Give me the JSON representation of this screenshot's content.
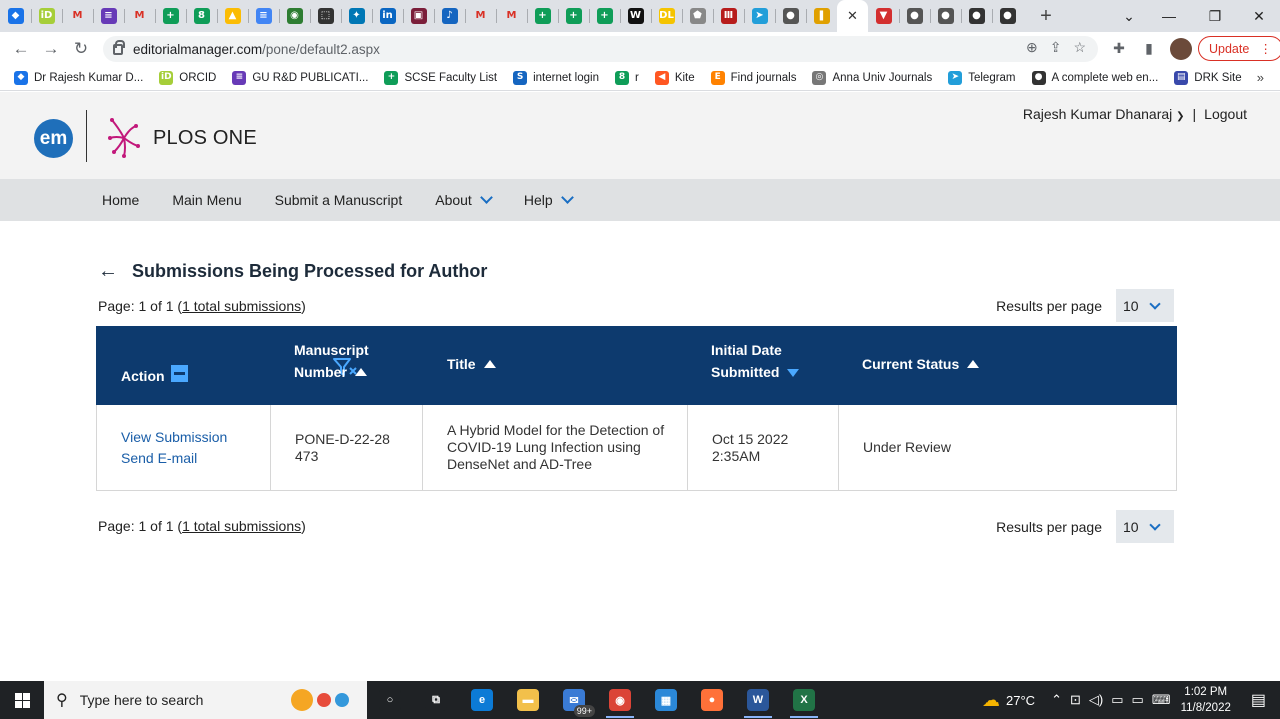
{
  "browser": {
    "tabs": [
      {
        "icon": "bookmark-star-icon",
        "color": "#1a73e8",
        "glyph": "◆"
      },
      {
        "icon": "orcid-icon",
        "color": "#a6ce39",
        "glyph": "iD"
      },
      {
        "icon": "gmail-icon",
        "color": "#ffffff",
        "glyph": "M"
      },
      {
        "icon": "form-icon",
        "color": "#673ab7",
        "glyph": "≡"
      },
      {
        "icon": "gmail-icon",
        "color": "#ffffff",
        "glyph": "M"
      },
      {
        "icon": "sheets-plus-icon",
        "color": "#0f9d58",
        "glyph": "+"
      },
      {
        "icon": "green-circle-icon",
        "color": "#0f9d58",
        "glyph": "8"
      },
      {
        "icon": "drive-icon",
        "color": "#fbbc04",
        "glyph": "▲"
      },
      {
        "icon": "docs-icon",
        "color": "#4285f4",
        "glyph": "≡"
      },
      {
        "icon": "eye-icon",
        "color": "#2e7d32",
        "glyph": "◉"
      },
      {
        "icon": "tool-icon",
        "color": "#333333",
        "glyph": "⬚"
      },
      {
        "icon": "bird-icon",
        "color": "#0077b5",
        "glyph": "✦"
      },
      {
        "icon": "linkedin-icon",
        "color": "#0a66c2",
        "glyph": "in"
      },
      {
        "icon": "journal-icon",
        "color": "#7b1e3a",
        "glyph": "▣"
      },
      {
        "icon": "scholar-icon",
        "color": "#1565c0",
        "glyph": "♪"
      },
      {
        "icon": "gmail-icon",
        "color": "#ffffff",
        "glyph": "M"
      },
      {
        "icon": "gmail-icon",
        "color": "#ffffff",
        "glyph": "M"
      },
      {
        "icon": "sheets-plus-icon",
        "color": "#0f9d58",
        "glyph": "+"
      },
      {
        "icon": "sheets-plus-icon",
        "color": "#0f9d58",
        "glyph": "+"
      },
      {
        "icon": "sheets-plus-icon",
        "color": "#0f9d58",
        "glyph": "+"
      },
      {
        "icon": "wikipedia-icon",
        "color": "#111111",
        "glyph": "W"
      },
      {
        "icon": "dl-icon",
        "color": "#f5c400",
        "glyph": "DL"
      },
      {
        "icon": "pentagon-icon",
        "color": "#888888",
        "glyph": "⬟"
      },
      {
        "icon": "pillar-icon",
        "color": "#b71c1c",
        "glyph": "Ⅲ"
      },
      {
        "icon": "telegram-icon",
        "color": "#229ed9",
        "glyph": "➤"
      },
      {
        "icon": "globe-icon",
        "color": "#555555",
        "glyph": "●"
      },
      {
        "icon": "rainbow-icon",
        "color": "#e0a000",
        "glyph": "❚"
      }
    ],
    "tabs_after": [
      {
        "icon": "vivaldi-red-icon",
        "color": "#d32f2f",
        "glyph": "▼"
      },
      {
        "icon": "globe-icon",
        "color": "#555555",
        "glyph": "●"
      },
      {
        "icon": "globe-icon",
        "color": "#555555",
        "glyph": "●"
      },
      {
        "icon": "github-icon",
        "color": "#333333",
        "glyph": "●"
      },
      {
        "icon": "github-icon",
        "color": "#333333",
        "glyph": "●"
      }
    ],
    "active_tab_close": "✕",
    "new_tab": "+",
    "url_host": "editorialmanager.com",
    "url_path": "/pone/default2.aspx",
    "update_label": "Update",
    "bookmarks": [
      {
        "label": "Dr Rajesh Kumar D...",
        "icon": "bookmark-star-icon",
        "color": "#1a73e8",
        "glyph": "◆"
      },
      {
        "label": "ORCID",
        "icon": "orcid-icon",
        "color": "#a6ce39",
        "glyph": "iD"
      },
      {
        "label": "GU R&D PUBLICATI...",
        "icon": "form-icon",
        "color": "#673ab7",
        "glyph": "≡"
      },
      {
        "label": "SCSE Faculty List",
        "icon": "sheets-plus-icon",
        "color": "#0f9d58",
        "glyph": "+"
      },
      {
        "label": "internet login",
        "icon": "s-icon",
        "color": "#1565c0",
        "glyph": "S"
      },
      {
        "label": "r",
        "icon": "green-circle-icon",
        "color": "#0f9d58",
        "glyph": "8"
      },
      {
        "label": "Kite",
        "icon": "kite-icon",
        "color": "#ff5722",
        "glyph": "◀"
      },
      {
        "label": "Find journals",
        "icon": "elsevier-icon",
        "color": "#ff8200",
        "glyph": "E"
      },
      {
        "label": "Anna Univ Journals",
        "icon": "anna-univ-icon",
        "color": "#777777",
        "glyph": "◎"
      },
      {
        "label": "Telegram",
        "icon": "telegram-icon",
        "color": "#229ed9",
        "glyph": "➤"
      },
      {
        "label": "A complete web en...",
        "icon": "github-icon",
        "color": "#333333",
        "glyph": "●"
      },
      {
        "label": "DRK Site",
        "icon": "site-icon",
        "color": "#3949ab",
        "glyph": "▤"
      }
    ],
    "bookmarks_more": "»"
  },
  "site": {
    "brand_initials": "em",
    "journal_name": "PLOS ONE",
    "user_name": "Rajesh Kumar Dhanaraj",
    "separator": "|",
    "logout_label": "Logout",
    "nav": [
      {
        "label": "Home",
        "has_menu": false
      },
      {
        "label": "Main Menu",
        "has_menu": false
      },
      {
        "label": "Submit a Manuscript",
        "has_menu": false
      },
      {
        "label": "About",
        "has_menu": true
      },
      {
        "label": "Help",
        "has_menu": true
      }
    ]
  },
  "main": {
    "heading": "Submissions Being Processed for Author",
    "page_info_prefix": "Page: 1 of 1 (",
    "page_info_link": "1 total submissions",
    "page_info_suffix": ")",
    "results_per_page_label": "Results per page",
    "results_per_page_value": "10",
    "columns": {
      "action": "Action",
      "manuscript_line1": "Manuscript",
      "manuscript_line2": "Number",
      "title": "Title",
      "date_line1": "Initial Date",
      "date_line2": "Submitted",
      "status": "Current Status"
    },
    "rows": [
      {
        "actions": [
          "View Submission",
          "Send E-mail"
        ],
        "manuscript_number": "PONE-D-22-28473",
        "title": "A Hybrid Model for the Detection of COVID-19 Lung Infection using DenseNet and AD-Tree",
        "date": "Oct 15 2022 2:35AM",
        "status": "Under Review"
      }
    ]
  },
  "taskbar": {
    "search_placeholder": "Type here to search",
    "apps": [
      {
        "icon": "cortana-circle-icon",
        "color": "#1f2225",
        "glyph": "○",
        "running": false
      },
      {
        "icon": "task-view-icon",
        "color": "#1f2225",
        "glyph": "⧉",
        "running": false
      },
      {
        "icon": "edge-icon",
        "color": "#0c7bd6",
        "glyph": "e",
        "running": false
      },
      {
        "icon": "file-explorer-icon",
        "color": "#f2c04b",
        "glyph": "▬",
        "running": false
      },
      {
        "icon": "mail-icon",
        "color": "#3a7bd5",
        "glyph": "✉",
        "running": false,
        "badge": "99+"
      },
      {
        "icon": "chrome-icon",
        "color": "#db4437",
        "glyph": "◉",
        "running": true
      },
      {
        "icon": "store-icon",
        "color": "#2b88d8",
        "glyph": "▦",
        "running": false
      },
      {
        "icon": "firefox-icon",
        "color": "#ff7139",
        "glyph": "●",
        "running": false
      },
      {
        "icon": "word-icon",
        "color": "#2b579a",
        "glyph": "W",
        "running": true
      },
      {
        "icon": "excel-icon",
        "color": "#217346",
        "glyph": "X",
        "running": true
      }
    ],
    "temperature": "27°C",
    "time": "1:02 PM",
    "date": "11/8/2022"
  }
}
